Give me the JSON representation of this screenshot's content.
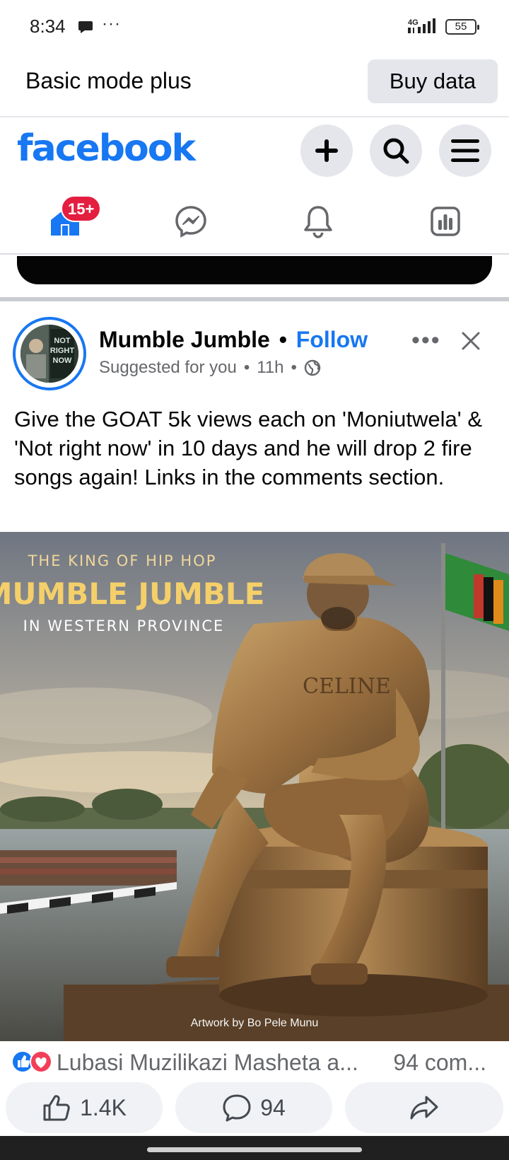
{
  "status_bar": {
    "time": "8:34",
    "more": "···",
    "network": "4G",
    "battery": "55"
  },
  "mode_bar": {
    "label": "Basic mode plus",
    "buy_button": "Buy data"
  },
  "header": {
    "logo": "facebook",
    "brand_color": "#1877f2",
    "icons": [
      "plus-icon",
      "search-icon",
      "menu-icon"
    ]
  },
  "nav": {
    "home_badge": "15+",
    "items": [
      "home-icon",
      "messenger-icon",
      "bell-icon",
      "dashboard-icon"
    ]
  },
  "post": {
    "author": "Mumble Jumble",
    "separator": "•",
    "follow_label": "Follow",
    "suggested": "Suggested for you",
    "dot": "•",
    "time": "11h",
    "text": "Give the GOAT 5k views each on 'Moniutwela' & 'Not right now' in 10 days and he will drop 2 fire songs again! Links in the comments section.",
    "avatar_text": "NOT RIGHT NOW",
    "image": {
      "line1": "THE KING OF HIP HOP",
      "line2": "MUMBLE JUMBLE",
      "line3": "IN WESTERN PROVINCE",
      "shirt_text": "CELINE",
      "credit": "Artwork by Bo Pele Munu"
    },
    "reactions_text": "Lubasi Muzilikazi Masheta a...",
    "comments_text": "94 com...",
    "like_count": "1.4K",
    "comment_count": "94"
  }
}
